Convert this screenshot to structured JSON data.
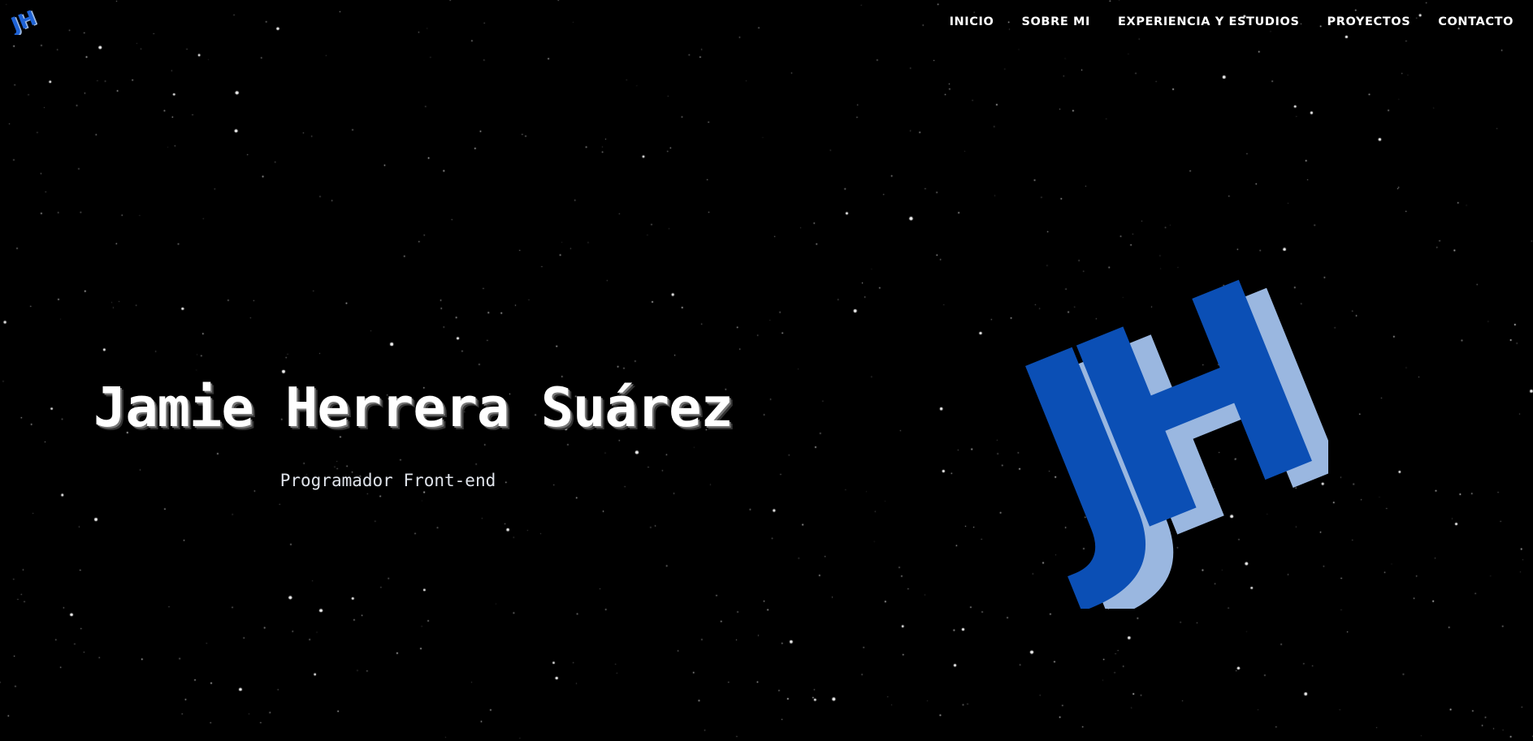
{
  "nav": {
    "logo_text": "JH",
    "items": [
      {
        "label": "INICIO"
      },
      {
        "label": "SOBRE MI"
      },
      {
        "label": "EXPERIENCIA Y ESTUDIOS"
      },
      {
        "label": "PROYECTOS"
      },
      {
        "label": "CONTACTO"
      }
    ]
  },
  "hero": {
    "name": "Jamie Herrera Suárez",
    "subtitle": "Programador Front-end",
    "logo_text": "JH"
  },
  "colors": {
    "background": "#000000",
    "text": "#ffffff",
    "logo_primary": "#0b4fb5",
    "logo_shadow": "#9ab7e0"
  }
}
